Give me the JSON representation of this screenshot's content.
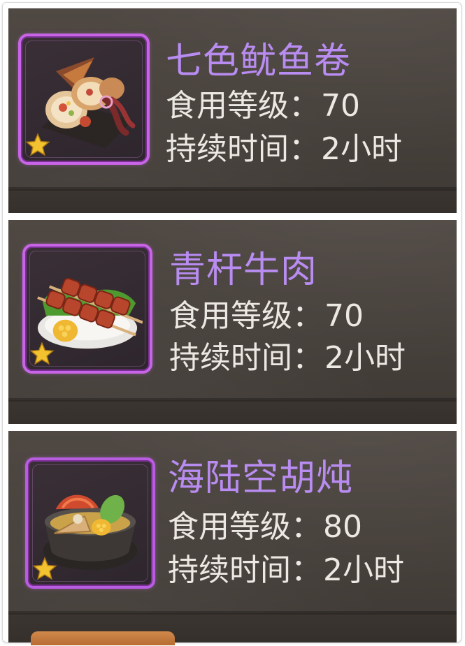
{
  "items": [
    {
      "name": "七色鱿鱼卷",
      "level_label": "食用等级：",
      "level_value": "70",
      "duration_label": "持续时间：",
      "duration_value": "2小时",
      "icon": "squid-roll-icon",
      "star": "star-icon"
    },
    {
      "name": "青杆牛肉",
      "level_label": "食用等级：",
      "level_value": "70",
      "duration_label": "持续时间：",
      "duration_value": "2小时",
      "icon": "beef-skewer-icon",
      "star": "star-icon"
    },
    {
      "name": "海陆空胡炖",
      "level_label": "食用等级：",
      "level_value": "80",
      "duration_label": "持续时间：",
      "duration_value": "2小时",
      "icon": "stew-pot-icon",
      "star": "star-icon"
    }
  ],
  "colors": {
    "item_name": "#b88cf0",
    "stat_text": "#ece8e2",
    "frame_border": "#c864e6",
    "panel_bg": "#4a433e",
    "star": "#f2c230"
  }
}
